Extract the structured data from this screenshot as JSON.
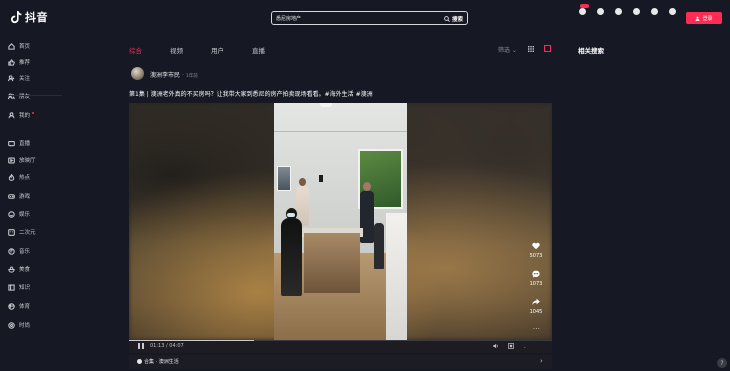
{
  "app": {
    "name": "抖音"
  },
  "search": {
    "value": "悉尼房地产",
    "button_label": "搜索"
  },
  "top_nav": {
    "items": [
      {
        "label": "",
        "icon": "wallet-icon",
        "badge": "NEW"
      },
      {
        "label": "",
        "icon": "monitor-icon"
      },
      {
        "label": "",
        "icon": "cloud-download-icon"
      },
      {
        "label": "",
        "icon": "bell-icon"
      },
      {
        "label": "",
        "icon": "message-icon"
      },
      {
        "label": "",
        "icon": "upload-icon"
      }
    ],
    "login_label": "登录"
  },
  "sidebar": {
    "items": [
      {
        "label": "首页",
        "icon": "home-icon"
      },
      {
        "label": "推荐",
        "icon": "thumb-icon"
      },
      {
        "label": "关注",
        "icon": "follow-icon"
      },
      {
        "label": "朋友",
        "icon": "friends-icon"
      },
      {
        "label": "我的",
        "icon": "user-icon",
        "dot": true
      },
      {
        "label": "直播",
        "icon": "tv-icon"
      },
      {
        "label": "放映厅",
        "icon": "screen-icon"
      },
      {
        "label": "热点",
        "icon": "fire-icon"
      },
      {
        "label": "游戏",
        "icon": "game-icon"
      },
      {
        "label": "娱乐",
        "icon": "smile-icon"
      },
      {
        "label": "二次元",
        "icon": "anime-icon"
      },
      {
        "label": "音乐",
        "icon": "music-icon"
      },
      {
        "label": "美食",
        "icon": "food-icon"
      },
      {
        "label": "知识",
        "icon": "book-icon"
      },
      {
        "label": "体育",
        "icon": "sport-icon"
      },
      {
        "label": "时尚",
        "icon": "fashion-icon"
      }
    ],
    "footer": []
  },
  "tabs": [
    {
      "label": "综合",
      "active": true
    },
    {
      "label": "视频",
      "active": false
    },
    {
      "label": "用户",
      "active": false
    },
    {
      "label": "直播",
      "active": false
    }
  ],
  "filter_label": "筛选",
  "post": {
    "author": "澳洲李市民",
    "time": "1年前",
    "caption": "第1集 | 澳洲老外真的不买房吗？让我带大家到悉尼的房产拍卖现场看看。#海外生活 #澳洲",
    "likes": "5073",
    "comments": "1073",
    "shares": "1045",
    "more": "···",
    "current_time": "01:13",
    "duration": "04:07",
    "progress": 0.296,
    "collection": "合集 · 澳洲生活",
    "controls": {
      "speed": "",
      "comment_label": ""
    }
  },
  "related": {
    "title": "相关搜索",
    "items": []
  },
  "help_label": "?",
  "colors": {
    "accent": "#fe2c55",
    "background": "#161823"
  }
}
